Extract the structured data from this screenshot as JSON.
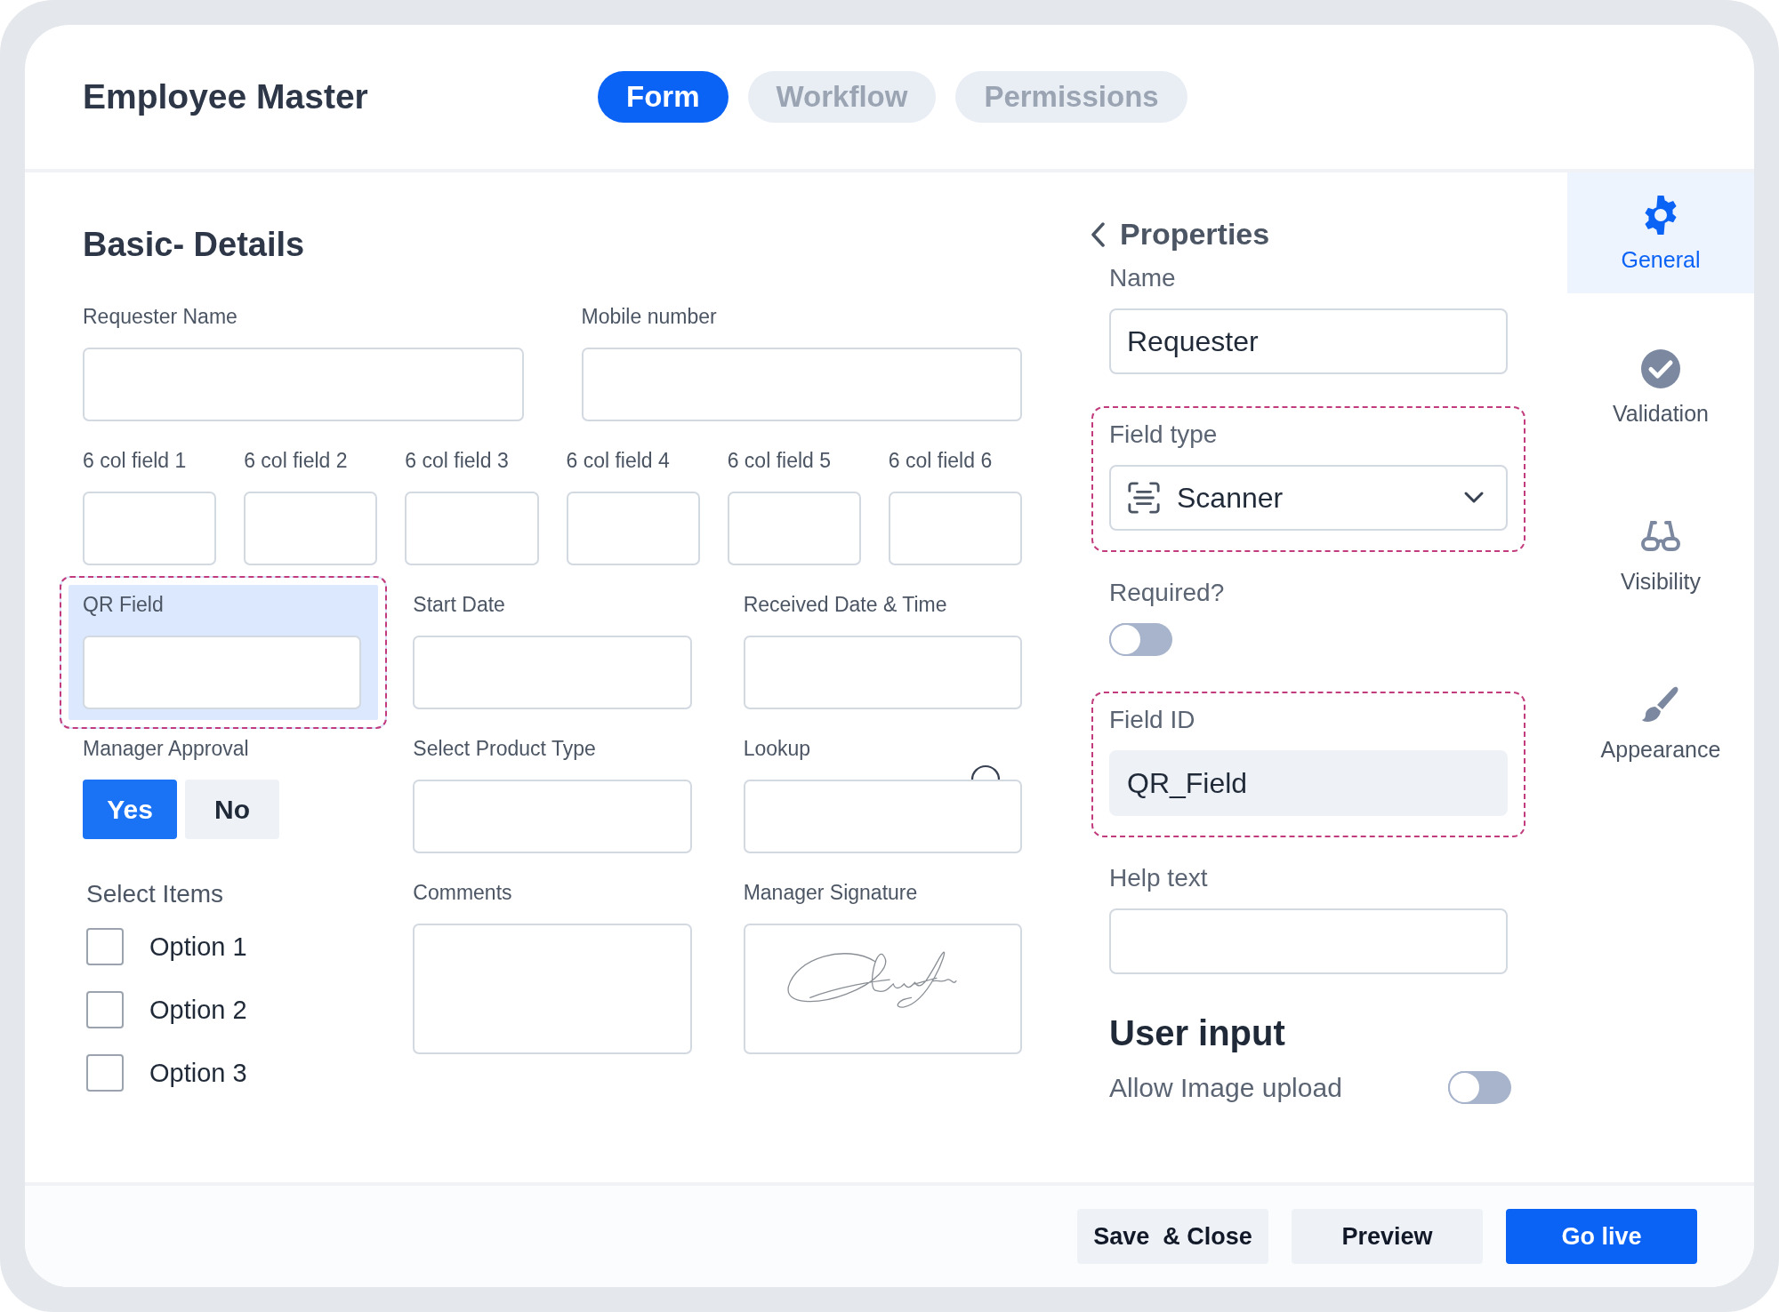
{
  "header": {
    "title": "Employee Master",
    "tabs": [
      {
        "label": "Form",
        "selected": true
      },
      {
        "label": "Workflow",
        "selected": false
      },
      {
        "label": "Permissions",
        "selected": false
      }
    ]
  },
  "form": {
    "title": "Basic- Details",
    "rows": [
      {
        "fields": [
          {
            "label": "Requester Name",
            "kind": "text",
            "selected": false
          },
          {
            "label": "Mobile number",
            "kind": "text",
            "selected": false
          }
        ]
      },
      {
        "fields": [
          {
            "label": "6 col field 1",
            "kind": "text",
            "selected": false
          },
          {
            "label": "6 col field 2",
            "kind": "text",
            "selected": false
          },
          {
            "label": "6 col field 3",
            "kind": "text",
            "selected": false
          },
          {
            "label": "6 col field 4",
            "kind": "text",
            "selected": false
          },
          {
            "label": "6 col field 5",
            "kind": "text",
            "selected": false
          },
          {
            "label": "6 col field 6",
            "kind": "text",
            "selected": false
          }
        ]
      },
      {
        "fields": [
          {
            "label": "QR Field",
            "kind": "text",
            "selected": true
          },
          {
            "label": "Start Date",
            "kind": "text",
            "selected": false
          },
          {
            "label": "Received Date & Time",
            "kind": "text",
            "selected": false
          }
        ]
      },
      {
        "fields": [
          {
            "label": "Manager Approval",
            "kind": "choice",
            "selected": false,
            "options": [
              {
                "label": "Yes",
                "selected": true
              },
              {
                "label": "No",
                "selected": false
              }
            ]
          },
          {
            "label": "Select Product Type",
            "kind": "text",
            "selected": false
          },
          {
            "label": "Lookup",
            "kind": "lookup",
            "selected": false
          }
        ]
      },
      {
        "fields": [
          {
            "label": "Select Items",
            "kind": "checklist",
            "selected": false,
            "options": [
              {
                "label": "Option 1",
                "checked": false
              },
              {
                "label": "Option 2",
                "checked": false
              },
              {
                "label": "Option 3",
                "checked": false
              }
            ]
          },
          {
            "label": "Comments",
            "kind": "textarea",
            "selected": false
          },
          {
            "label": "Manager Signature",
            "kind": "signature",
            "selected": false
          }
        ]
      }
    ]
  },
  "properties": {
    "title": "Properties",
    "fields": [
      {
        "label": "Name",
        "kind": "text",
        "value": "Requester",
        "highlighted": false
      },
      {
        "label": "Field type",
        "kind": "select",
        "value": "Scanner",
        "highlighted": true
      },
      {
        "label": "Required?",
        "kind": "toggle",
        "on": false,
        "highlighted": false
      },
      {
        "label": "Field ID",
        "kind": "readonly",
        "value": "QR_Field",
        "highlighted": true
      },
      {
        "label": "Help text",
        "kind": "text",
        "highlighted": false
      }
    ],
    "user_input": {
      "title": "User input",
      "settings": [
        {
          "label": "Allow Image upload",
          "on": false
        }
      ]
    }
  },
  "sidebar": {
    "items": [
      {
        "label": "General",
        "selected": true
      },
      {
        "label": "Validation",
        "selected": false
      },
      {
        "label": "Visibility",
        "selected": false
      },
      {
        "label": "Appearance",
        "selected": false
      }
    ]
  },
  "footer": {
    "buttons": [
      {
        "label": "Save  & Close",
        "kind": "secondary"
      },
      {
        "label": "Preview",
        "kind": "secondary"
      },
      {
        "label": "Go live",
        "kind": "primary"
      }
    ]
  }
}
